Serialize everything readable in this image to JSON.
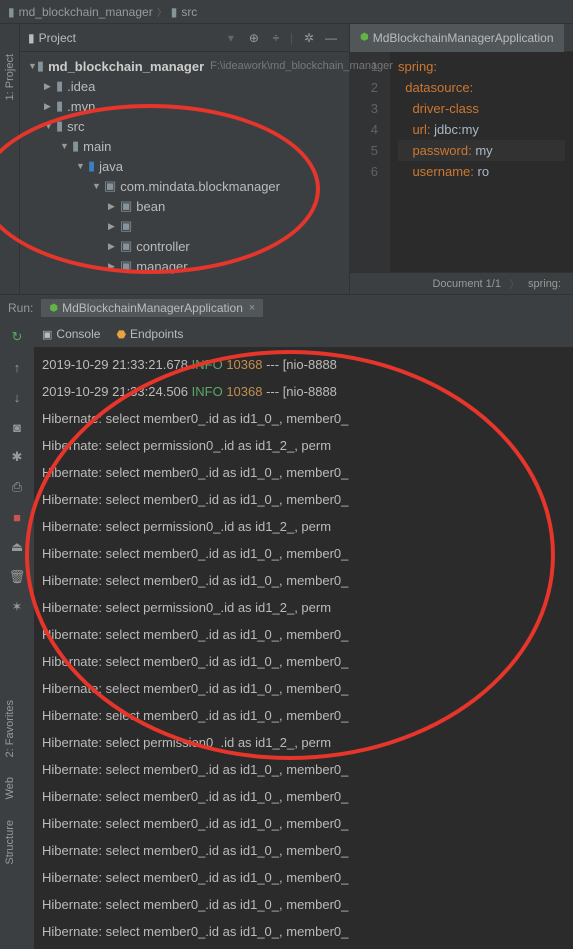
{
  "breadcrumb": {
    "root": "md_blockchain_manager",
    "child": "src"
  },
  "project": {
    "title": "Project",
    "root": "md_blockchain_manager",
    "rootPath": "F:\\ideawork\\md_blockchain_manager",
    "idea": ".idea",
    "mvn": ".mvn",
    "src": "src",
    "main": "main",
    "java": "java",
    "pkg": "com.mindata.blockmanager",
    "bean": "bean",
    "controller": "controller",
    "manager": "manager"
  },
  "sidebarTabs": {
    "project": "1: Project"
  },
  "bottomTabs": {
    "fav": "2: Favorites",
    "web": "Web",
    "struct": "Structure"
  },
  "editor": {
    "tabName": "MdBlockchainManagerApplication",
    "status": {
      "doc": "Document 1/1",
      "path": "spring:"
    },
    "lines": [
      {
        "k": "spring",
        "v": ""
      },
      {
        "k": "datasource",
        "v": ""
      },
      {
        "k": "driver-class",
        "v": ""
      },
      {
        "k": "url",
        "v": "jdbc:my"
      },
      {
        "k": "password",
        "v": "my"
      },
      {
        "k": "username",
        "v": "ro"
      }
    ]
  },
  "run": {
    "label": "Run:",
    "tabName": "MdBlockchainManagerApplication",
    "consoleTab": "Console",
    "endpointsTab": "Endpoints",
    "lines": [
      "2019-10-29 21:33:21.678  INFO 10368 --- [nio-8888",
      "2019-10-29 21:33:24.506  INFO 10368 --- [nio-8888",
      "Hibernate: select member0_.id as id1_0_, member0_",
      "Hibernate: select permission0_.id as id1_2_, perm",
      "Hibernate: select member0_.id as id1_0_, member0_",
      "Hibernate: select member0_.id as id1_0_, member0_",
      "Hibernate: select permission0_.id as id1_2_, perm",
      "Hibernate: select member0_.id as id1_0_, member0_",
      "Hibernate: select member0_.id as id1_0_, member0_",
      "Hibernate: select permission0_.id as id1_2_, perm",
      "Hibernate: select member0_.id as id1_0_, member0_",
      "Hibernate: select member0_.id as id1_0_, member0_",
      "Hibernate: select member0_.id as id1_0_, member0_",
      "Hibernate: select member0_.id as id1_0_, member0_",
      "Hibernate: select permission0_.id as id1_2_, perm",
      "Hibernate: select member0_.id as id1_0_, member0_",
      "Hibernate: select member0_.id as id1_0_, member0_",
      "Hibernate: select member0_.id as id1_0_, member0_",
      "Hibernate: select member0_.id as id1_0_, member0_",
      "Hibernate: select member0_.id as id1_0_, member0_",
      "Hibernate: select member0_.id as id1_0_, member0_",
      "Hibernate: select member0_.id as id1_0_, member0_"
    ]
  }
}
